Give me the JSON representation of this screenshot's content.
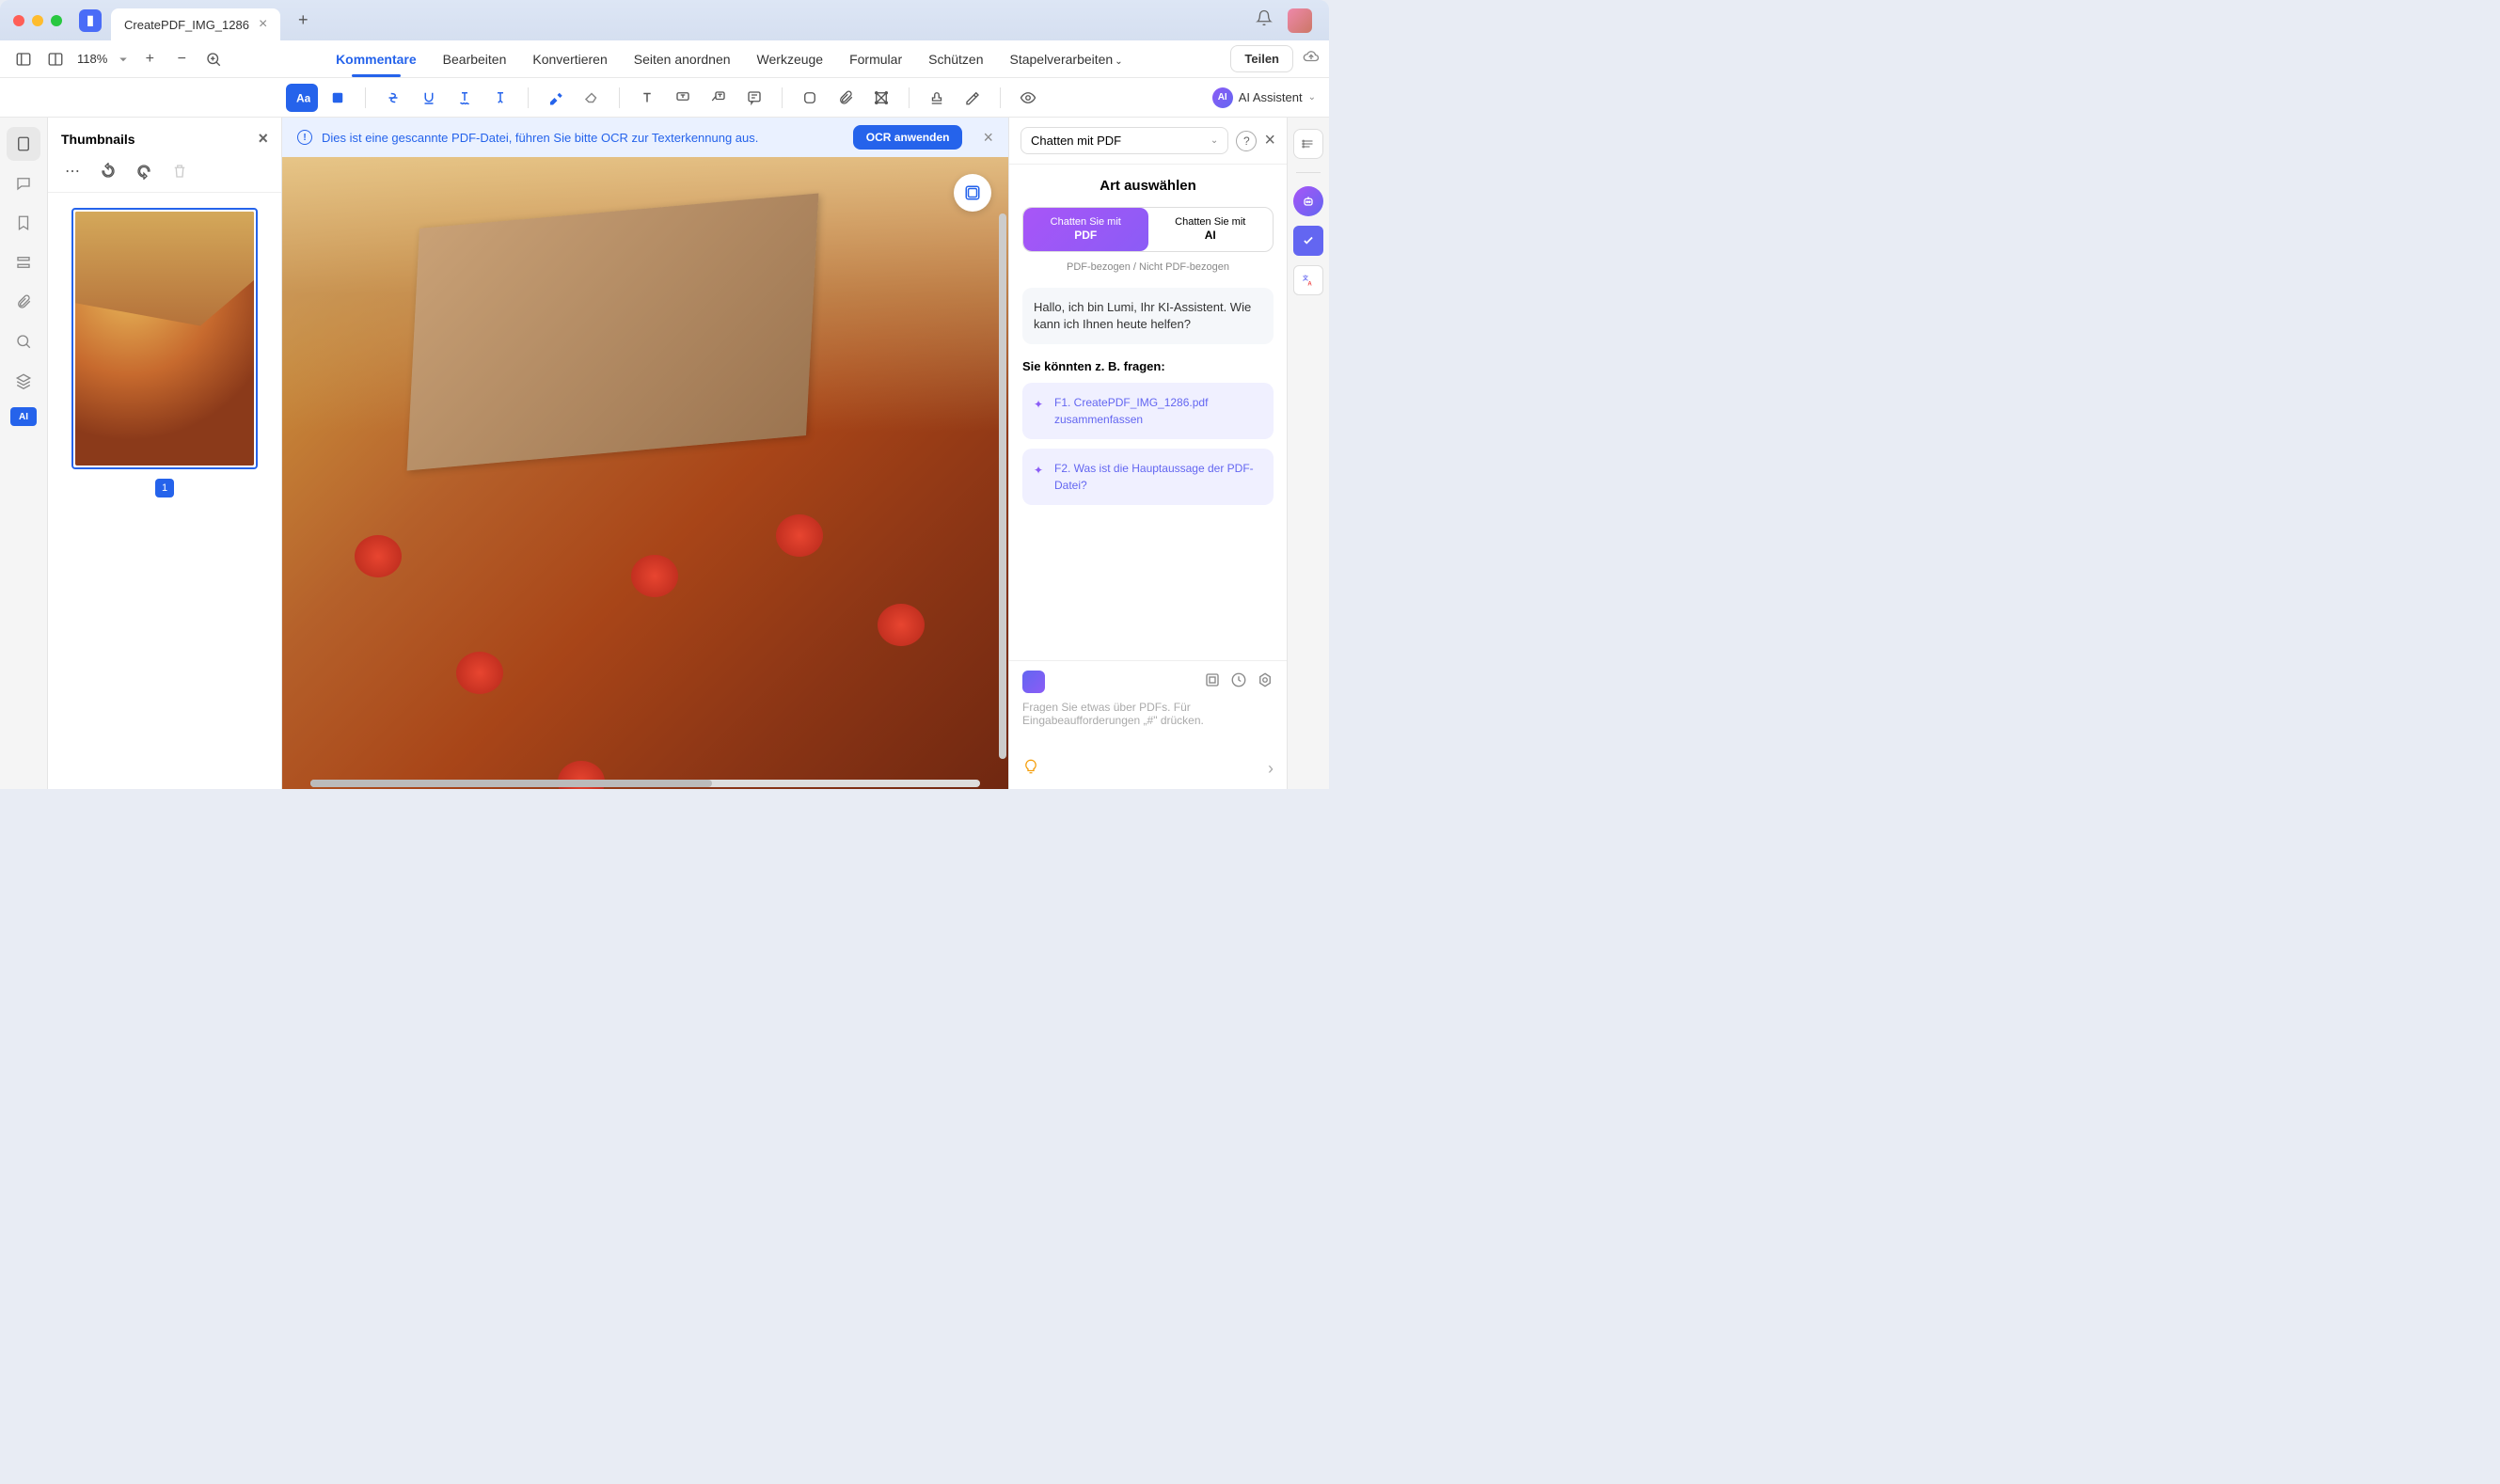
{
  "titlebar": {
    "tab_title": "CreatePDF_IMG_1286"
  },
  "menubar": {
    "zoom": "118%",
    "tabs": [
      "Kommentare",
      "Bearbeiten",
      "Konvertieren",
      "Seiten anordnen",
      "Werkzeuge",
      "Formular",
      "Schützen",
      "Stapelverarbeiten"
    ],
    "active_tab_index": 0,
    "share_label": "Teilen"
  },
  "toolbar": {
    "ai_assistant_label": "AI Assistent"
  },
  "thumbnails": {
    "title": "Thumbnails",
    "page_number": "1"
  },
  "ocr_banner": {
    "message": "Dies ist eine gescannte PDF-Datei, führen Sie bitte OCR zur Texterkennung aus.",
    "button": "OCR anwenden"
  },
  "ai_panel": {
    "dropdown": "Chatten mit PDF",
    "title": "Art auswählen",
    "toggle_pdf_line1": "Chatten Sie mit",
    "toggle_pdf_line2": "PDF",
    "toggle_ai_line1": "Chatten Sie mit",
    "toggle_ai_line2": "AI",
    "subtext": "PDF-bezogen / Nicht PDF-bezogen",
    "greeting": "Hallo, ich bin Lumi, Ihr KI-Assistent. Wie kann ich Ihnen heute helfen?",
    "suggest_title": "Sie könnten z. B. fragen:",
    "suggestions": [
      "F1. CreatePDF_IMG_1286.pdf zusammenfassen",
      "F2. Was ist die Hauptaussage der PDF-Datei?"
    ],
    "input_placeholder": "Fragen Sie etwas über PDFs. Für Eingabeaufforderungen „#\" drücken."
  }
}
